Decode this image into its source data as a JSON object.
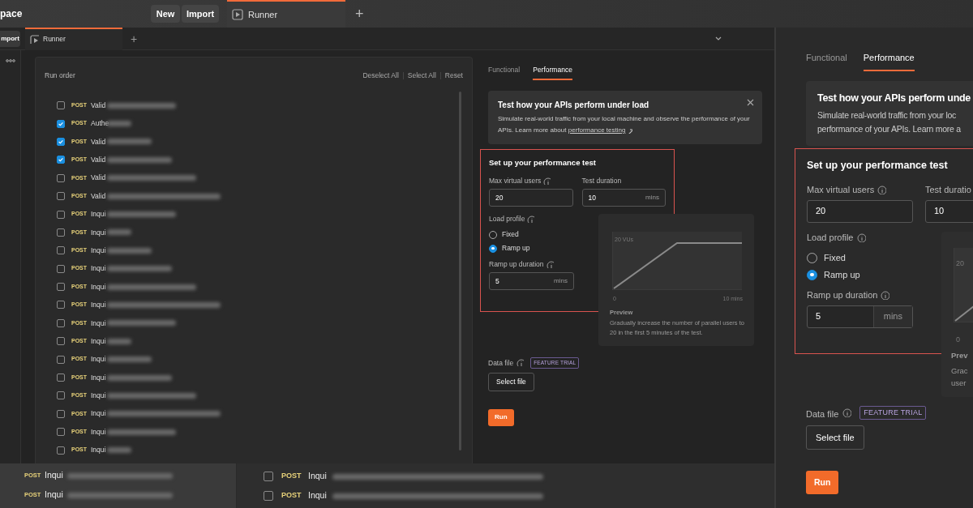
{
  "top_bar": {
    "workspace": "pace",
    "buttons": [
      "New",
      "Import"
    ],
    "tabs": [
      {
        "label": "Runner",
        "selected": true
      }
    ],
    "add_tab": "+"
  },
  "window": {
    "import_button": "mport",
    "tabs": [
      {
        "label": "Runner",
        "selected": true
      }
    ],
    "add_tab": "+"
  },
  "run_order": {
    "title": "Run order",
    "actions": [
      "Deselect All",
      "Select All",
      "Reset"
    ],
    "requests": [
      {
        "method": "POST",
        "name": "Valid",
        "checked": false
      },
      {
        "method": "POST",
        "name": "Authe",
        "checked": true
      },
      {
        "method": "POST",
        "name": "Valid",
        "checked": true
      },
      {
        "method": "POST",
        "name": "Valid",
        "checked": true
      },
      {
        "method": "POST",
        "name": "Valid",
        "checked": false
      },
      {
        "method": "POST",
        "name": "Valid",
        "checked": false
      },
      {
        "method": "POST",
        "name": "Inqui",
        "checked": false
      },
      {
        "method": "POST",
        "name": "Inqui",
        "checked": false
      },
      {
        "method": "POST",
        "name": "Inqui",
        "checked": false
      },
      {
        "method": "POST",
        "name": "Inqui",
        "checked": false
      },
      {
        "method": "POST",
        "name": "Inqui",
        "checked": false
      },
      {
        "method": "POST",
        "name": "Inqui",
        "checked": false
      },
      {
        "method": "POST",
        "name": "Inqui",
        "checked": false
      },
      {
        "method": "POST",
        "name": "Inqui",
        "checked": false
      },
      {
        "method": "POST",
        "name": "Inqui",
        "checked": false
      },
      {
        "method": "POST",
        "name": "Inqui",
        "checked": false
      },
      {
        "method": "POST",
        "name": "Inqui",
        "checked": false
      },
      {
        "method": "POST",
        "name": "Inqui",
        "checked": false
      },
      {
        "method": "POST",
        "name": "Inqui",
        "checked": false
      },
      {
        "method": "POST",
        "name": "Inqui",
        "checked": false
      }
    ]
  },
  "runner": {
    "tabs": [
      {
        "label": "Functional",
        "selected": false
      },
      {
        "label": "Performance",
        "selected": true
      }
    ],
    "banner": {
      "title": "Test how your APIs perform under load",
      "text": "Simulate real-world traffic from your local machine and observe the performance of your APIs. Learn more about",
      "link": "performance testing"
    },
    "setup": {
      "title": "Set up your performance test",
      "max_users": {
        "label": "Max virtual users",
        "value": "20"
      },
      "duration": {
        "label": "Test duration",
        "value": "10",
        "unit": "mins"
      },
      "load_profile": {
        "label": "Load profile",
        "options": [
          {
            "label": "Fixed",
            "selected": false
          },
          {
            "label": "Ramp up",
            "selected": true
          }
        ]
      },
      "ramp_up": {
        "label": "Ramp up duration",
        "value": "5",
        "unit": "mins"
      }
    },
    "preview": {
      "y_label": "20 VUs",
      "x_start": "0",
      "x_end": "10 mins",
      "title": "Preview",
      "text": "Gradually increase the number of parallel users to 20 in the first 5 minutes of the test."
    },
    "data_file": {
      "label": "Data file",
      "badge": "FEATURE TRIAL",
      "button": "Select file"
    },
    "run_button": "Run"
  },
  "zoom_panel": {
    "tabs": [
      {
        "label": "Functional",
        "selected": false
      },
      {
        "label": "Performance",
        "selected": true
      }
    ],
    "banner": {
      "title": "Test how your APIs perform unde",
      "text_lines": [
        "Simulate real-world traffic from your loc",
        "performance of your APIs. Learn more a"
      ]
    },
    "setup": {
      "title": "Set up your performance test",
      "max_users": {
        "label": "Max virtual users",
        "value": "20"
      },
      "duration": {
        "label": "Test duratio",
        "value": "10"
      },
      "load_profile": {
        "label": "Load profile",
        "options": [
          {
            "label": "Fixed",
            "selected": false
          },
          {
            "label": "Ramp up",
            "selected": true
          }
        ]
      },
      "ramp_up": {
        "label": "Ramp up duration",
        "value": "5",
        "unit": "mins"
      }
    },
    "preview": {
      "y_label": "20",
      "x_start": "0",
      "title": "Prev",
      "text_lines": [
        "Grac",
        "user"
      ]
    },
    "data_file": {
      "label": "Data file",
      "badge": "FEATURE TRIAL",
      "button": "Select file"
    },
    "run_button": "Run"
  },
  "background_rows": {
    "left": [
      {
        "method": "POST",
        "name": "Inqui"
      },
      {
        "method": "POST",
        "name": "Inqui"
      }
    ],
    "middle": [
      {
        "method": "POST",
        "name": "Inqui",
        "checked": false
      },
      {
        "method": "POST",
        "name": "Inqui",
        "checked": false
      }
    ]
  }
}
